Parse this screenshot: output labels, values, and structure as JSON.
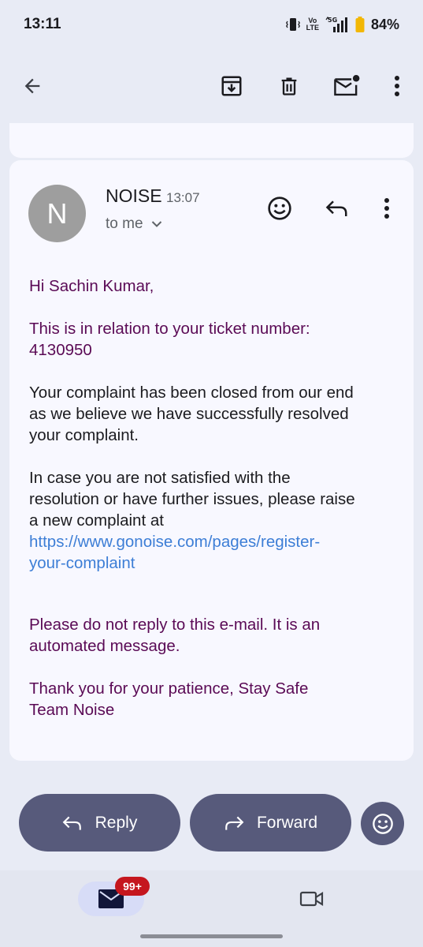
{
  "status_bar": {
    "time": "13:11",
    "volte_top": "Vo",
    "volte_bottom": "LTE",
    "network": "5G",
    "battery": "84%"
  },
  "app_bar": {
    "icons": [
      "back-arrow-icon",
      "archive-icon",
      "delete-icon",
      "mark-unread-icon",
      "more-vert-icon"
    ]
  },
  "message": {
    "avatar_letter": "N",
    "sender": "NOISE",
    "time": "13:07",
    "recipient": "to me",
    "greeting": "Hi Sachin Kumar,",
    "ticket_line": "This is in relation to your ticket number:",
    "ticket_number": "4130950",
    "para_closed_1": "Your complaint has been closed from our end",
    "para_closed_2": "as we believe we have successfully resolved",
    "para_closed_3": "your complaint.",
    "para_case_1": "In case you are not satisfied with the",
    "para_case_2": "resolution or have further issues, please raise",
    "para_case_3": "a new complaint at",
    "link_1": "https://www.gonoise.com/pages/register-",
    "link_2": "your-complaint",
    "noreply_1": "Please do not reply to this e-mail. It is an",
    "noreply_2": "automated message.",
    "thanks": "Thank you for your patience, Stay Safe",
    "signature": "Team Noise"
  },
  "actions": {
    "reply_label": "Reply",
    "forward_label": "Forward"
  },
  "bottom_nav": {
    "mail_badge": "99+"
  },
  "colors": {
    "accent_pill": "#575a7b",
    "purple_text": "#5a0a55",
    "link": "#3d7ed6",
    "badge": "#c5161e"
  }
}
